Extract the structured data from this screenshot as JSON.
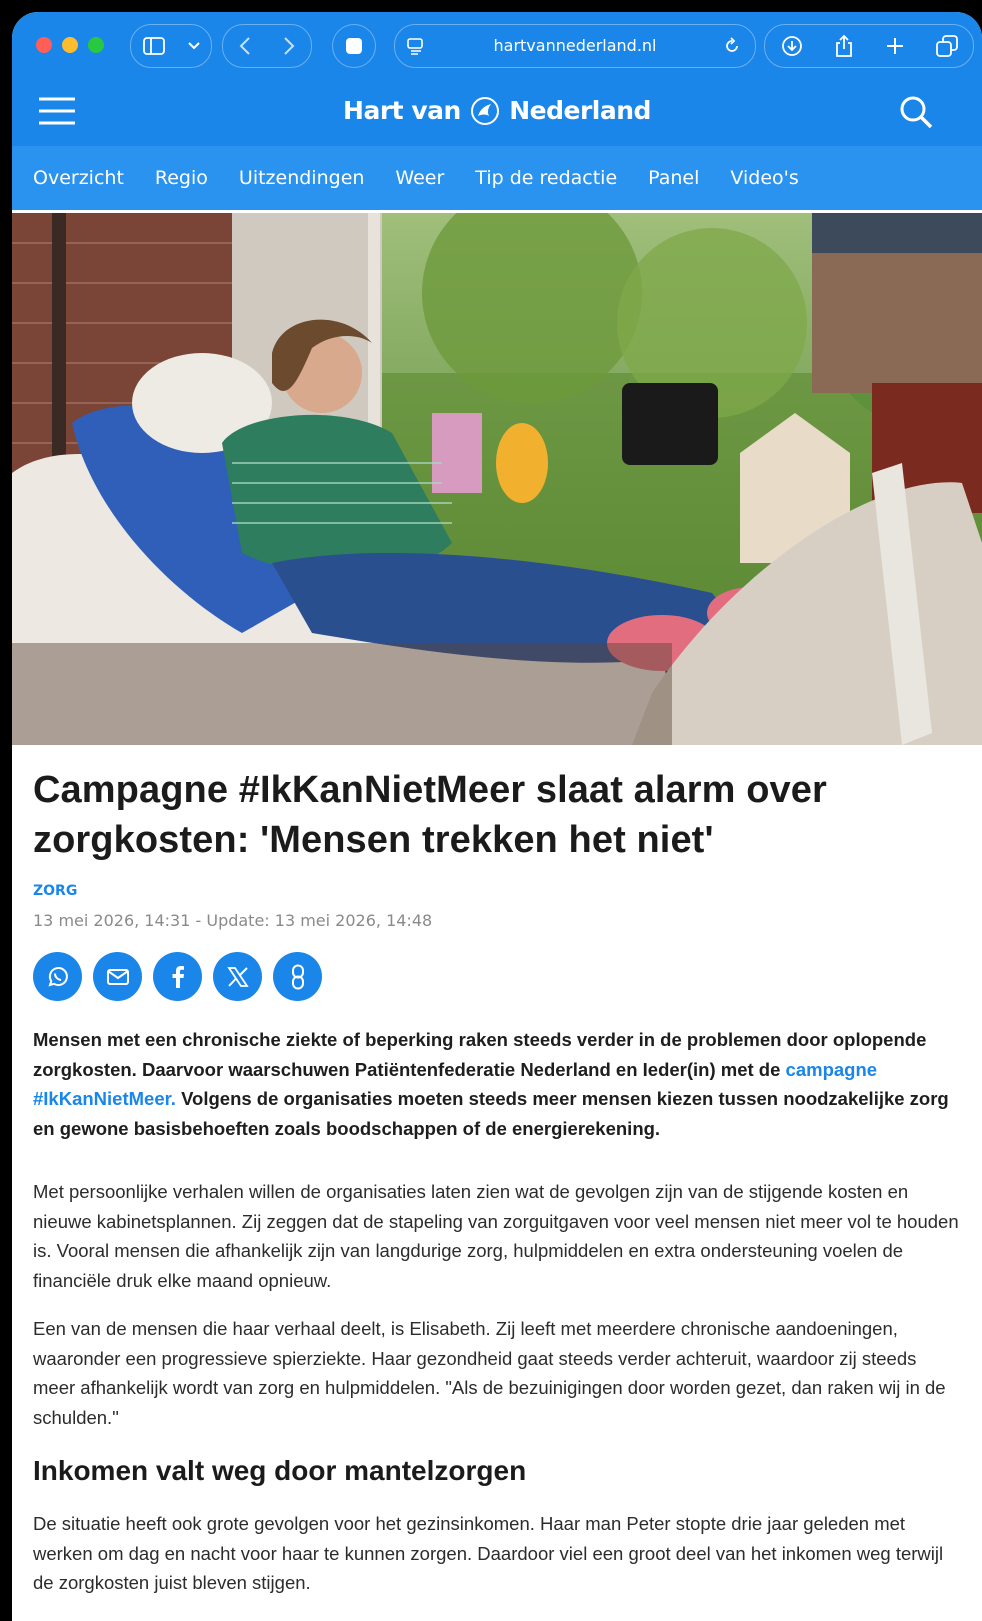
{
  "browser": {
    "url": "hartvannederland.nl",
    "traffic_colors": [
      "#ff5f57",
      "#febc2e",
      "#28c840"
    ]
  },
  "site": {
    "logo_left": "Hart van",
    "logo_right": "Nederland",
    "nav": [
      "Overzicht",
      "Regio",
      "Uitzendingen",
      "Weer",
      "Tip de redactie",
      "Panel",
      "Video's"
    ],
    "accent_color": "#1a86ea"
  },
  "article": {
    "title": "Campagne #IkKanNietMeer slaat alarm over zorgkosten: 'Mensen trekken het niet'",
    "category": "ZORG",
    "dateline": "13 mei 2026, 14:31 - Update: 13 mei 2026, 14:48",
    "share": [
      "whatsapp-icon",
      "mail-icon",
      "facebook-icon",
      "x-icon",
      "link-icon"
    ],
    "lead_before": "Mensen met een chronische ziekte of beperking raken steeds verder in de problemen door oplopende zorgkosten. Daarvoor waarschuwen Patiëntenfederatie Nederland en Ieder(in) met de ",
    "lead_link": "campagne #IkKanNietMeer.",
    "lead_after": " Volgens de organisaties moeten steeds meer mensen kiezen tussen noodzakelijke zorg en gewone basisbehoeften zoals boodschappen of de energierekening.",
    "paragraph1": "Met persoonlijke verhalen willen de organisaties laten zien wat de gevolgen zijn van de stijgende kosten en nieuwe kabinetsplannen. Zij zeggen dat de stapeling van zorguitgaven voor veel mensen niet meer vol te houden is. Vooral mensen die afhankelijk zijn van langdurige zorg, hulpmiddelen en extra ondersteuning voelen de financiële druk elke maand opnieuw.",
    "paragraph2": "Een van de mensen die haar verhaal deelt, is Elisabeth. Zij leeft met meerdere chronische aandoeningen, waaronder een progressieve spierziekte. Haar gezondheid gaat steeds verder achteruit, waardoor zij steeds meer afhankelijk wordt van zorg en hulpmiddelen. \"Als de bezuinigingen door worden gezet, dan raken wij in de schulden.\"",
    "subheading": "Inkomen valt weg door mantelzorgen",
    "paragraph3": "De situatie heeft ook grote gevolgen voor het gezinsinkomen. Haar man Peter stopte drie jaar geleden met werken om dag en nacht voor haar te kunnen zorgen. Daardoor viel een groot deel van het inkomen weg terwijl de zorgkosten juist bleven stijgen."
  }
}
